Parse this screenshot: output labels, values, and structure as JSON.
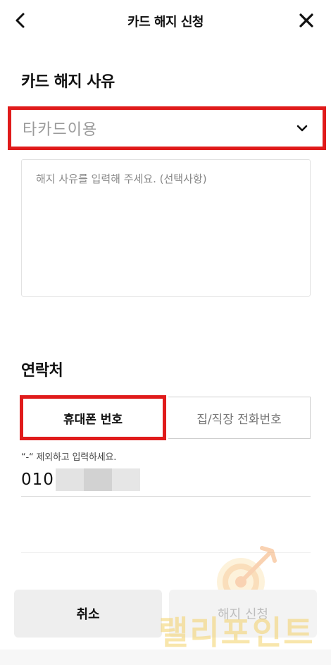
{
  "header": {
    "title": "카드 해지 신청",
    "back_icon": "chevron-left-icon",
    "close_icon": "close-icon"
  },
  "reason": {
    "section_title": "카드 해지 사유",
    "selected_value": "타카드이용",
    "dropdown_icon": "chevron-down-icon",
    "textarea_placeholder": "해지 사유를 입력해 주세요. (선택사항)"
  },
  "contact": {
    "section_title": "연락처",
    "tabs": [
      {
        "label": "휴대폰 번호",
        "selected": true
      },
      {
        "label": "집/직장 전화번호",
        "selected": false
      }
    ],
    "hint": "“-“ 제외하고 입력하세요.",
    "phone_prefix": "010"
  },
  "buttons": {
    "cancel_label": "취소",
    "submit_label": "해지 신청"
  },
  "watermark": {
    "text": "랠리포인트"
  },
  "colors": {
    "highlight": "#e01b1b",
    "placeholder": "#9a9a9a",
    "watermark": "#f4d26a"
  }
}
